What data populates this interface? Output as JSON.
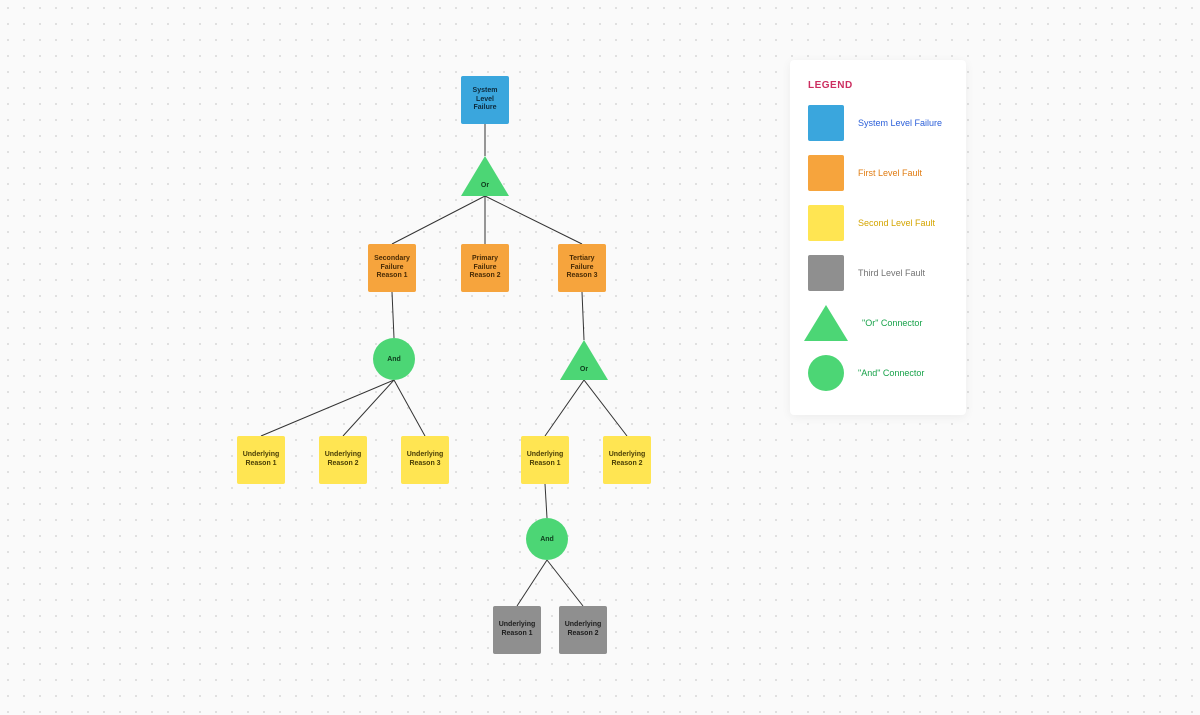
{
  "legend": {
    "title": "LEGEND",
    "items": [
      {
        "label": "System Level Failure"
      },
      {
        "label": "First Level Fault"
      },
      {
        "label": "Second Level Fault"
      },
      {
        "label": "Third Level Fault"
      },
      {
        "label": "\"Or\" Connector"
      },
      {
        "label": "\"And\" Connector"
      }
    ]
  },
  "colors": {
    "system": "#3aa6dd",
    "first": "#f6a43d",
    "second": "#ffe552",
    "third": "#8f8f8f",
    "gate": "#4cd675"
  },
  "nodes": {
    "root": {
      "label": "System Level Failure"
    },
    "or1": {
      "label": "Or"
    },
    "fault1": {
      "label": "Secondary Failure Reason 1"
    },
    "fault2": {
      "label": "Primary Failure Reason 2"
    },
    "fault3": {
      "label": "Tertiary Failure Reason 3"
    },
    "and1": {
      "label": "And"
    },
    "or2": {
      "label": "Or"
    },
    "secA1": {
      "label": "Underlying Reason 1"
    },
    "secA2": {
      "label": "Underlying Reason 2"
    },
    "secA3": {
      "label": "Underlying Reason 3"
    },
    "secB1": {
      "label": "Underlying Reason 1"
    },
    "secB2": {
      "label": "Underlying Reason 2"
    },
    "and2": {
      "label": "And"
    },
    "terC1": {
      "label": "Underlying Reason 1"
    },
    "terC2": {
      "label": "Underlying Reason 2"
    }
  }
}
